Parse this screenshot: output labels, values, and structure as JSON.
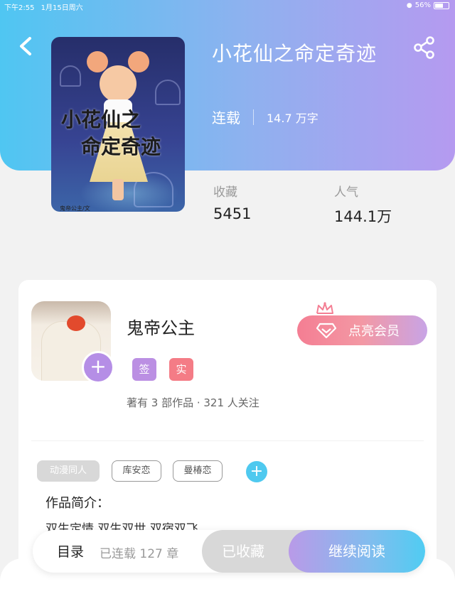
{
  "status_bar": {
    "time": "下午2:55",
    "date": "1月15日周六",
    "battery": "56%",
    "wifi_icon": "wifi-icon"
  },
  "book": {
    "title": "小花仙之命定奇迹",
    "status": "连载",
    "word_count": "14.7 万字",
    "cover": {
      "title_line1": "小花仙之",
      "title_line2": "命定奇迹",
      "author_credit": "鬼帝公主/文"
    },
    "stats": [
      {
        "label": "收藏",
        "value": "5451"
      },
      {
        "label": "人气",
        "value": "144.1万"
      }
    ]
  },
  "author": {
    "name": "鬼帝公主",
    "badges": [
      "签",
      "实"
    ],
    "meta": "著有 3 部作品 · 321 人关注",
    "vip_button": "点亮会员"
  },
  "tags": [
    "动漫同人",
    "库安恋",
    "曼椿恋"
  ],
  "intro": {
    "label": "作品简介：",
    "text": "双生定情    双生双世    双宿双飞"
  },
  "bottom_bar": {
    "toc": "目录",
    "chapter_count": "已连载 127 章",
    "collected": "已收藏",
    "continue_reading": "继续阅读"
  },
  "colors": {
    "header_start": "#4fc6f2",
    "header_end": "#b59af0",
    "vip_pink": "#f47e93",
    "badge_purple": "#bb8fe3",
    "badge_red": "#f47c86",
    "add_blue": "#4fc9ef"
  }
}
